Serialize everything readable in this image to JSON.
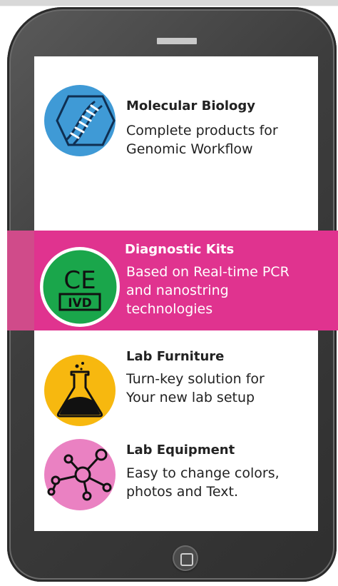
{
  "colors": {
    "accent": "#e0338f",
    "phone_body": "#3d3d3d",
    "molecular_icon": "#3f9ad6",
    "diagnostic_icon": "#1aa64b",
    "furniture_icon": "#f7b80f",
    "equipment_icon": "#ea81c2"
  },
  "items": [
    {
      "title": "Molecular Biology",
      "desc": [
        "Complete products for",
        "Genomic Workflow"
      ],
      "icon": "dna-icon"
    },
    {
      "title": "Diagnostic Kits",
      "desc": [
        "Based on Real-time PCR",
        "and nanostring",
        "technologies"
      ],
      "icon": "ce-ivd-icon",
      "ce": "CE",
      "ivd": "IVD"
    },
    {
      "title": "Lab Furniture",
      "desc": [
        "Turn-key solution for",
        "Your new lab setup"
      ],
      "icon": "flask-icon"
    },
    {
      "title": "Lab Equipment",
      "desc": [
        "Easy to change colors,",
        "photos and Text."
      ],
      "icon": "network-icon"
    }
  ]
}
